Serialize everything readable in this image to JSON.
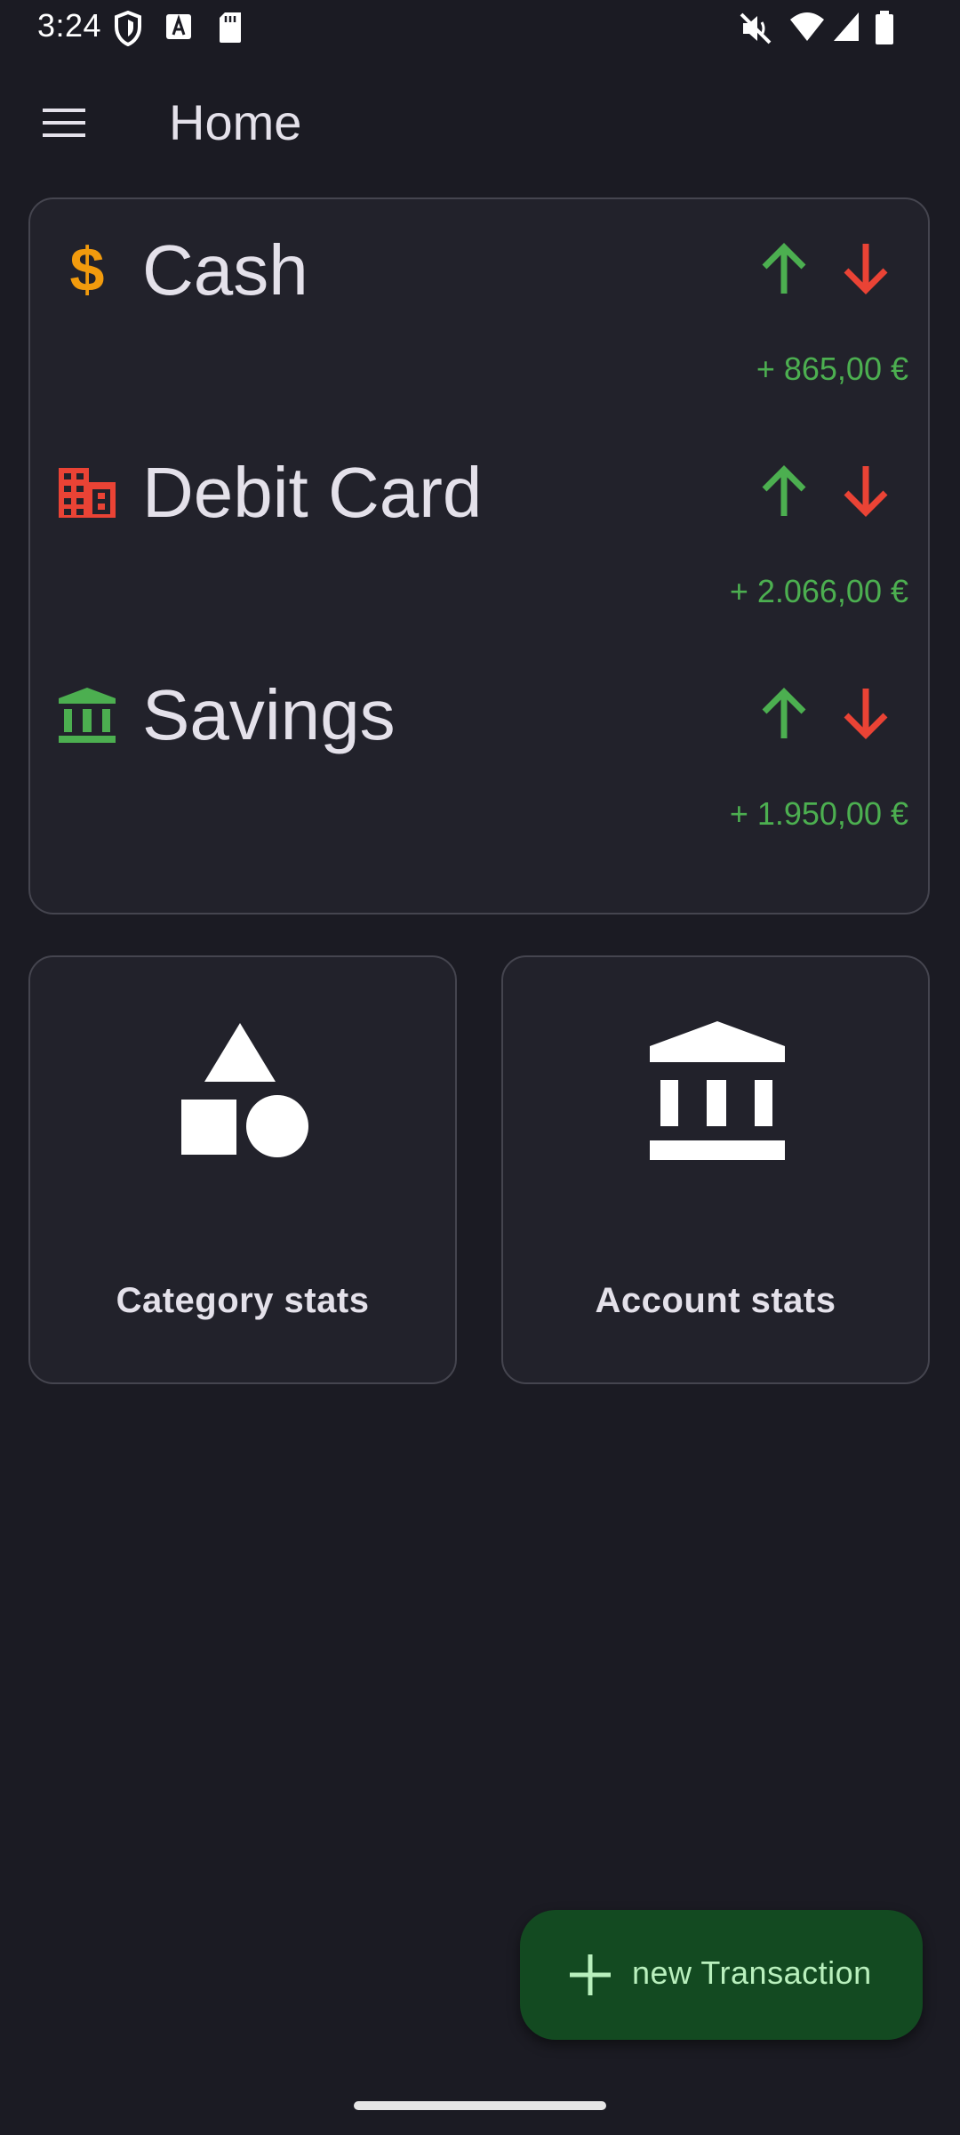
{
  "status_bar": {
    "time": "3:24"
  },
  "app_bar": {
    "title": "Home",
    "menu_icon": "hamburger-menu-icon"
  },
  "accounts": [
    {
      "name": "Cash",
      "icon": "dollar-icon",
      "icon_color": "#f29b0d",
      "balance": "+ 865,00 €"
    },
    {
      "name": "Debit Card",
      "icon": "building-icon",
      "icon_color": "#ea4335",
      "balance": "+ 2.066,00 €"
    },
    {
      "name": "Savings",
      "icon": "bank-icon",
      "icon_color": "#4caf50",
      "balance": "+ 1.950,00 €"
    }
  ],
  "stats": {
    "category": {
      "label": "Category stats",
      "icon": "shapes-icon"
    },
    "account": {
      "label": "Account stats",
      "icon": "bank-icon"
    }
  },
  "fab": {
    "label": "new Transaction",
    "icon": "plus-icon"
  },
  "colors": {
    "background": "#1b1b23",
    "card": "#22222b",
    "income_green": "#4caf50",
    "expense_red": "#ea4335",
    "fab_bg": "#134a21",
    "fab_text": "#b9f0bd"
  }
}
